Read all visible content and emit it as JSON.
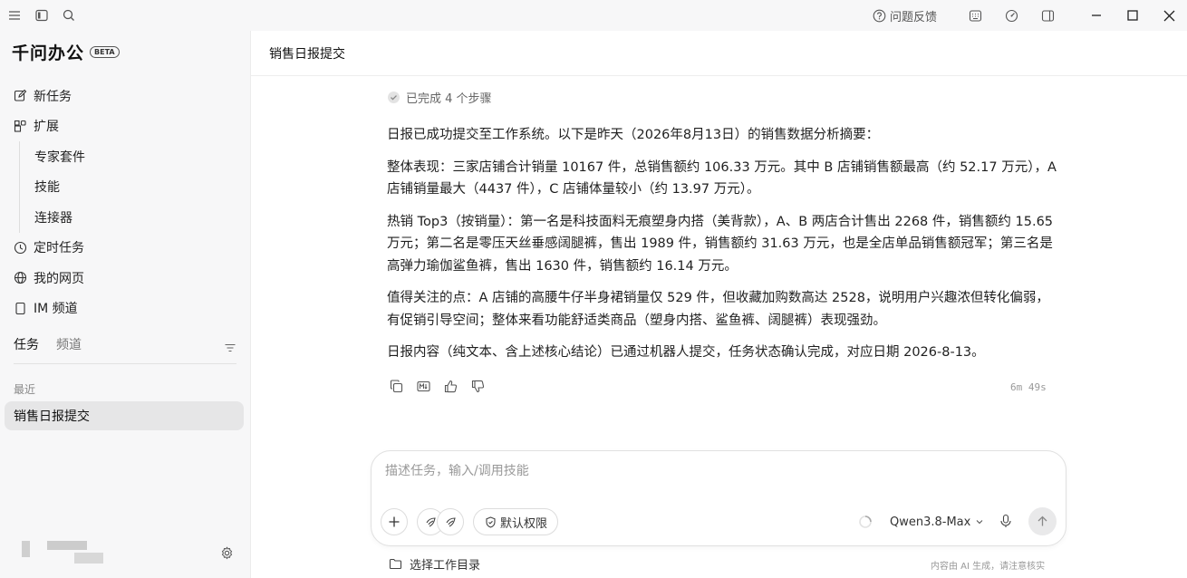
{
  "titlebar": {
    "feedback_label": "问题反馈"
  },
  "sidebar": {
    "brand": "千问办公",
    "beta": "BETA",
    "nav": {
      "new_task": "新任务",
      "extensions": "扩展",
      "expert_suite": "专家套件",
      "skills": "技能",
      "connectors": "连接器",
      "scheduled": "定时任务",
      "webpages": "我的网页",
      "im_channel": "IM 频道"
    },
    "tabs": {
      "tasks": "任务",
      "channels": "频道"
    },
    "recent_label": "最近",
    "recent_tasks": [
      "销售日报提交"
    ]
  },
  "main": {
    "title": "销售日报提交",
    "steps": "已完成 4 个步骤",
    "paragraphs": [
      "日报已成功提交至工作系统。以下是昨天（2026年8月13日）的销售数据分析摘要：",
      "整体表现：三家店铺合计销量 10167 件，总销售额约 106.33 万元。其中 B 店铺销售额最高（约 52.17 万元），A 店铺销量最大（4437 件），C 店铺体量较小（约 13.97 万元）。",
      "热销 Top3（按销量）：第一名是科技面料无痕塑身内搭（美背款），A、B 两店合计售出 2268 件，销售额约 15.65 万元；第二名是零压天丝垂感阔腿裤，售出 1989 件，销售额约 31.63 万元，也是全店单品销售额冠军；第三名是高弹力瑜伽鲨鱼裤，售出 1630 件，销售额约 16.14 万元。",
      "值得关注的点：A 店铺的高腰牛仔半身裙销量仅 529 件，但收藏加购数高达 2528，说明用户兴趣浓但转化偏弱，有促销引导空间；整体来看功能舒适类商品（塑身内搭、鲨鱼裤、阔腿裤）表现强劲。",
      "日报内容（纯文本、含上述核心结论）已通过机器人提交，任务状态确认完成，对应日期 2026-8-13。"
    ],
    "elapsed": "6m 49s"
  },
  "composer": {
    "placeholder": "描述任务，输入/调用技能",
    "permission_label": "默认权限",
    "model": "Qwen3.8-Max"
  },
  "footer": {
    "workdir_label": "选择工作目录",
    "disclaimer": "内容由 AI 生成，请注意核实"
  },
  "colors": {
    "sidebar_bg": "#f7f7f8",
    "main_bg": "#ffffff",
    "selected_item_bg": "#e6e6e7"
  }
}
